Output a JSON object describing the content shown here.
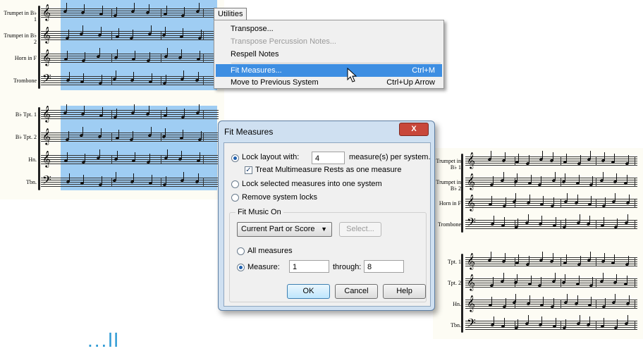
{
  "menu": {
    "button_label": "Utilities",
    "items": [
      {
        "label": "Transpose...",
        "shortcut": "",
        "state": "normal"
      },
      {
        "label": "Transpose Percussion Notes...",
        "shortcut": "",
        "state": "disabled"
      },
      {
        "label": "Respell Notes",
        "shortcut": "",
        "state": "normal"
      },
      {
        "label": "Fit Measures...",
        "shortcut": "Ctrl+M",
        "state": "active"
      },
      {
        "label": "Move to Previous System",
        "shortcut": "Ctrl+Up Arrow",
        "state": "normal"
      }
    ]
  },
  "dialog": {
    "title": "Fit Measures",
    "close_label": "X",
    "lock_layout_label": "Lock layout with:",
    "lock_layout_value": "4",
    "measures_per_system_label": "measure(s) per system.",
    "treat_multirest_label": "Treat Multimeasure Rests as one measure",
    "treat_multirest_checked": true,
    "lock_selected_label": "Lock selected measures into one system",
    "remove_locks_label": "Remove system locks",
    "selected_option": "lock_layout",
    "group_title": "Fit Music On",
    "scope_select_value": "Current Part or Score",
    "select_button_label": "Select...",
    "all_measures_label": "All measures",
    "measure_label": "Measure:",
    "measure_from": "1",
    "through_label": "through:",
    "measure_to": "8",
    "range_option": "measure",
    "ok_label": "OK",
    "cancel_label": "Cancel",
    "help_label": "Help"
  },
  "scores": {
    "left_top_labels": [
      "Trumpet in B♭ 1",
      "Trumpet in B♭ 2",
      "Horn in F",
      "Trombone"
    ],
    "left_bottom_labels": [
      "B♭ Tpt. 1",
      "B♭ Tpt. 2",
      "Hn.",
      "Tbn."
    ],
    "right_top_labels": [
      "Trumpet in B♭ 1",
      "Trumpet in B♭ 2",
      "Horn in F",
      "Trombone"
    ],
    "right_bottom_labels": [
      "Tpt. 1",
      "Tpt. 2",
      "Hn.",
      "Tbn."
    ]
  },
  "colors": {
    "selection": "#8ec4f2",
    "menu_highlight": "#3d8ee2",
    "accent_text": "#2e9ad4"
  },
  "footer_text": "...ll"
}
